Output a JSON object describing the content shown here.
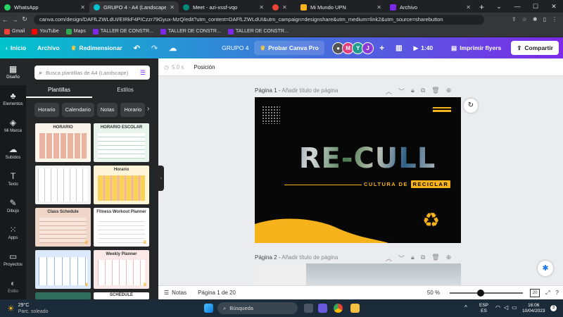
{
  "browser": {
    "tabs": [
      {
        "title": "WhatsApp",
        "color": "#25d366",
        "active": false
      },
      {
        "title": "GRUPO 4 - A4 (Landscape)",
        "color": "#00c4cc",
        "active": true
      },
      {
        "title": "Meet - azi-xssf-vqo",
        "color": "#00897b",
        "active": false
      },
      {
        "title": "",
        "color": "#ea4335",
        "active": false
      },
      {
        "title": "Mi Mundo UPN",
        "color": "#f6b21a",
        "active": false
      },
      {
        "title": "Archivo",
        "color": "#7d2ae8",
        "active": false
      }
    ],
    "url": "canva.com/design/DAFfLZWLdUI/EIRkF4PICzzr79Gyux-MzQ/edit?utm_content=DAFfLZWLdUI&utm_campaign=designshare&utm_medium=link2&utm_source=sharebutton",
    "bookmarks": [
      {
        "label": "Gmail",
        "color": "#ea4335"
      },
      {
        "label": "YouTube",
        "color": "#ff0000"
      },
      {
        "label": "Maps",
        "color": "#34a853"
      },
      {
        "label": "TALLER DE CONSTR...",
        "color": "#7d2ae8"
      },
      {
        "label": "TALLER DE CONSTR...",
        "color": "#7d2ae8"
      },
      {
        "label": "TALLER DE CONSTR...",
        "color": "#7d2ae8"
      }
    ]
  },
  "canva": {
    "inicio": "Inicio",
    "archivo": "Archivo",
    "redimensionar": "Redimensionar",
    "group_name": "GRUPO 4",
    "try_pro": "Probar Canva Pro",
    "avatars": [
      {
        "letter": "M",
        "color": "#e23b7e"
      },
      {
        "letter": "Y",
        "color": "#1f9d8e"
      },
      {
        "letter": "J",
        "color": "#8e3ad8"
      }
    ],
    "timer": "1:40",
    "imprimir": "Imprimir flyers",
    "compartir": "Compartir"
  },
  "rail": [
    {
      "label": "Diseño",
      "icon": "▦"
    },
    {
      "label": "Elementos",
      "icon": "♣"
    },
    {
      "label": "Mi Marca",
      "icon": "◈"
    },
    {
      "label": "Subidos",
      "icon": "☁"
    },
    {
      "label": "Texto",
      "icon": "T"
    },
    {
      "label": "Dibujo",
      "icon": "✎"
    },
    {
      "label": "Apps",
      "icon": "⁙"
    },
    {
      "label": "Proyectos",
      "icon": "▭"
    },
    {
      "label": "Estilo",
      "icon": "◐"
    }
  ],
  "panel": {
    "search_placeholder": "Busca plantillas de A4 (Landscape)",
    "tabs": [
      "Plantillas",
      "Estilos"
    ],
    "chips": [
      "Horario",
      "Calendario",
      "Notas",
      "Horario"
    ],
    "thumb_titles": [
      "HORARIO",
      "HORARIO ESCOLAR",
      "",
      "Horario",
      "Class Schedule",
      "Fitness Workout Planner",
      "",
      "Weekly Planner",
      "",
      "SCHEDULE"
    ]
  },
  "editor": {
    "duration": "5.0 s",
    "position": "Posición",
    "page1_label": "Página 1",
    "page2_label": "Página 2",
    "page_title_placeholder": "Añadir título de página",
    "design_title": "RE-CULL",
    "design_subtitle": "CULTURA DE",
    "design_subtitle_hl": "RECICLAR",
    "notes": "Notas",
    "page_count": "Página 1 de 20",
    "zoom": "50 %",
    "zoom_level": 50,
    "page_num_badge": "20"
  },
  "taskbar": {
    "weather_temp": "29°C",
    "weather_desc": "Parc. soleado",
    "search": "Búsqueda",
    "lang": "ESP",
    "lang2": "ES",
    "time": "16:06",
    "date": "10/04/2023"
  }
}
